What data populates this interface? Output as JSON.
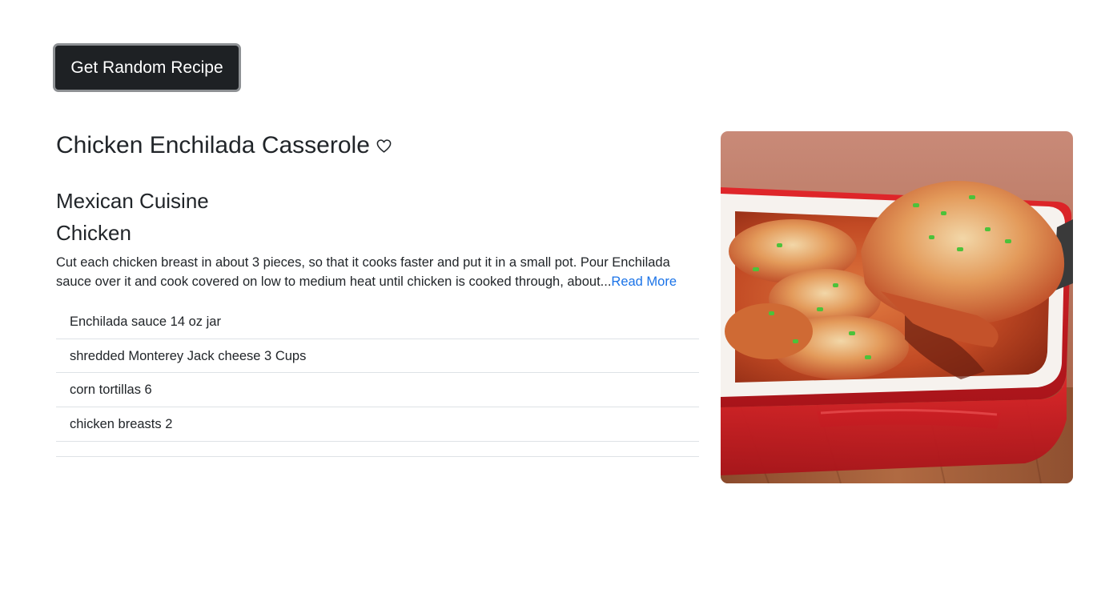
{
  "controls": {
    "random_button_label": "Get Random Recipe"
  },
  "recipe": {
    "title": "Chicken Enchilada Casserole",
    "favorite_icon": "heart-outline-icon",
    "cuisine": "Mexican Cuisine",
    "category": "Chicken",
    "instructions_preview": "Cut each chicken breast in about 3 pieces, so that it cooks faster and put it in a small pot. Pour Enchilada sauce over it and cook covered on low to medium heat until chicken is cooked through, about...",
    "read_more_label": "Read More",
    "ingredients": [
      "Enchilada sauce 14 oz jar",
      "shredded Monterey Jack cheese 3 Cups",
      "corn tortillas 6",
      "chicken breasts 2"
    ],
    "image_subject": "enchilada casserole in red baking dish"
  },
  "colors": {
    "button_bg": "#1e2124",
    "button_border": "#8e9194",
    "link": "#1a73e8",
    "divider": "#dee2e6"
  }
}
